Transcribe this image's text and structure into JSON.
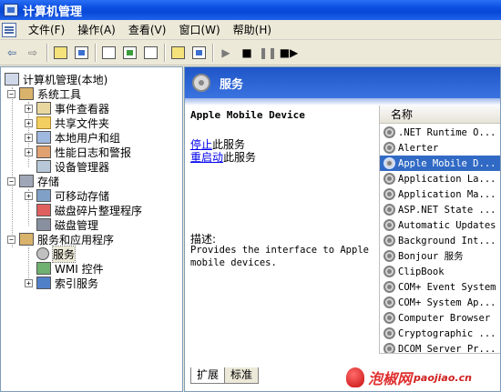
{
  "window": {
    "title": "计算机管理"
  },
  "menu": {
    "items": [
      "文件(F)",
      "操作(A)",
      "查看(V)",
      "窗口(W)",
      "帮助(H)"
    ]
  },
  "tree": {
    "root": "计算机管理(本地)",
    "system_tools": "系统工具",
    "event_viewer": "事件查看器",
    "shared_folders": "共享文件夹",
    "local_users": "本地用户和组",
    "perf_logs": "性能日志和警报",
    "device_manager": "设备管理器",
    "storage": "存储",
    "removable": "可移动存储",
    "defrag": "磁盘碎片整理程序",
    "disk_mgmt": "磁盘管理",
    "services_apps": "服务和应用程序",
    "services": "服务",
    "wmi": "WMI 控件",
    "indexing": "索引服务"
  },
  "right": {
    "header": "服务",
    "selected_service": "Apple Mobile Device",
    "stop_link": "停止",
    "stop_suffix": "此服务",
    "restart_link": "重启动",
    "restart_suffix": "此服务",
    "desc_label": "描述:",
    "desc_text": "Provides the interface to Apple mobile devices."
  },
  "list": {
    "column_name": "名称",
    "items": [
      ".NET Runtime O...",
      "Alerter",
      "Apple Mobile D...",
      "Application La...",
      "Application Ma...",
      "ASP.NET State ...",
      "Automatic Updates",
      "Background Int...",
      "Bonjour 服务",
      "ClipBook",
      "COM+ Event System",
      "COM+ System Ap...",
      "Computer Browser",
      "Cryptographic ...",
      "DCOM Server Pr..."
    ],
    "selected_index": 2
  },
  "tabs": {
    "extended": "扩展",
    "standard": "标准"
  },
  "watermark": {
    "text": "泡椒网",
    "domain": "paojiao.cn"
  },
  "colors": {
    "title_blue": "#0a4ee0",
    "selection": "#316ac5",
    "header_blue": "#1f56c8"
  }
}
